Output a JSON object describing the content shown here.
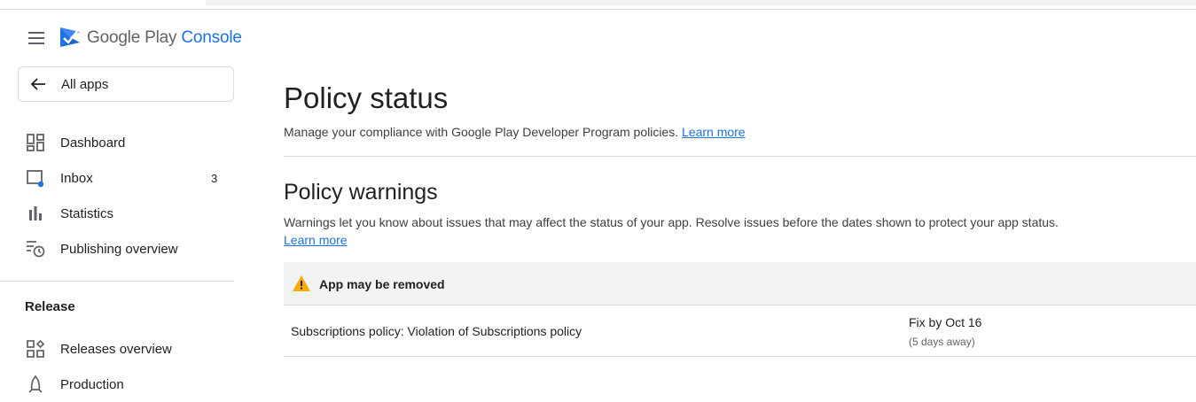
{
  "header": {
    "brand_google": "Google Play",
    "brand_console": "Console"
  },
  "sidebar": {
    "all_apps": "All apps",
    "items": [
      {
        "label": "Dashboard",
        "icon": "dashboard-icon"
      },
      {
        "label": "Inbox",
        "icon": "inbox-icon",
        "count": "3"
      },
      {
        "label": "Statistics",
        "icon": "bar-chart-icon"
      },
      {
        "label": "Publishing overview",
        "icon": "publishing-overview-icon"
      }
    ],
    "section": "Release",
    "release_items": [
      {
        "label": "Releases overview",
        "icon": "releases-overview-icon"
      },
      {
        "label": "Production",
        "icon": "production-icon"
      }
    ]
  },
  "main": {
    "title": "Policy status",
    "subtitle": "Manage your compliance with Google Play Developer Program policies.",
    "learn_more": "Learn more",
    "warnings_title": "Policy warnings",
    "warnings_desc": "Warnings let you know about issues that may affect the status of your app. Resolve issues before the dates shown to protect your app status.",
    "warnings_learn_more": "Learn more",
    "warning_group": {
      "label": "App may be removed",
      "icon": "warning-icon",
      "rows": [
        {
          "policy": "Subscriptions policy: Violation of Subscriptions policy",
          "fix_by": "Fix by Oct 16",
          "days_away": "(5 days away)"
        }
      ]
    }
  },
  "colors": {
    "accent": "#1a73e8",
    "warning": "#f9ab00",
    "badge_dot": "#1a73e8"
  }
}
